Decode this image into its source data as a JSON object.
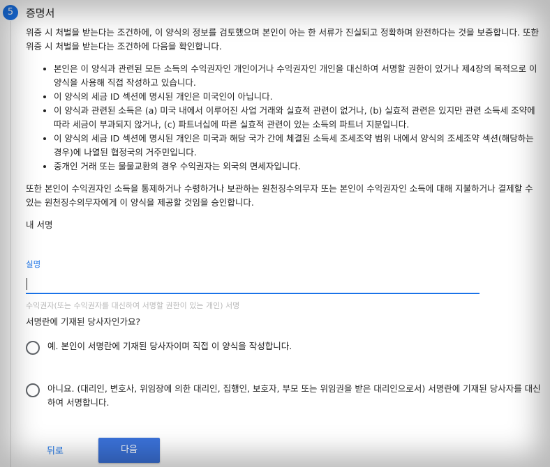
{
  "step": {
    "number": "5",
    "title": "증명서"
  },
  "intro": "위증 시 처벌을 받는다는 조건하에, 이 양식의 정보를 검토했으며 본인이 아는 한 서류가 진실되고 정확하며 완전하다는 것을 보증합니다. 또한 위증 시 처벌을 받는다는 조건하에 다음을 확인합니다.",
  "bullets": [
    "본인은 이 양식과 관련된 모든 소득의 수익권자인 개인이거나 수익권자인 개인을 대신하여 서명할 권한이 있거나 제4장의 목적으로 이 양식을 사용해 직접 작성하고 있습니다.",
    "이 양식의 세금 ID 섹션에 명시된 개인은 미국인이 아닙니다.",
    "이 양식과 관련된 소득은 (a) 미국 내에서 이루어진 사업 거래와 실효적 관련이 없거나, (b) 실효적 관련은 있지만 관련 소득세 조약에 따라 세금이 부과되지 않거나, (c) 파트너십에 따른 실효적 관련이 있는 소득의 파트너 지분입니다.",
    "이 양식의 세금 ID 섹션에 명시된 개인은 미국과 해당 국가 간에 체결된 소득세 조세조약 범위 내에서 양식의 조세조약 섹션(해당하는 경우)에 나열된 협정국의 거주민입니다.",
    "중개인 거래 또는 물물교환의 경우 수익권자는 외국의 면세자입니다."
  ],
  "authorization": "또한 본인이 수익권자인 소득을 통제하거나 수령하거나 보관하는 원천징수의무자 또는 본인이 수익권자인 소득에 대해 지불하거나 결제할 수 있는 원천징수의무자에게 이 양식을 제공할 것임을 승인합니다.",
  "signature": {
    "heading": "내 서명",
    "name_label": "실명",
    "name_value": "",
    "hint": "수익권자(또는 수익권자를 대신하여 서명할 권한이 있는 개인) 서명"
  },
  "question": "서명란에 기재된 당사자인가요?",
  "options": [
    {
      "label": "예. 본인이 서명란에 기재된 당사자이며 직접 이 양식을 작성합니다.",
      "selected": false
    },
    {
      "label": "아니요. (대리인, 변호사, 위임장에 의한 대리인, 집행인, 보호자, 부모 또는 위임권을 받은 대리인으로서) 서명란에 기재된 당사자를 대신하여 서명합니다.",
      "selected": false
    }
  ],
  "buttons": {
    "back": "뒤로",
    "next": "다음"
  },
  "colors": {
    "accent": "#1a73e8",
    "primary_button": "#3b72d9"
  }
}
